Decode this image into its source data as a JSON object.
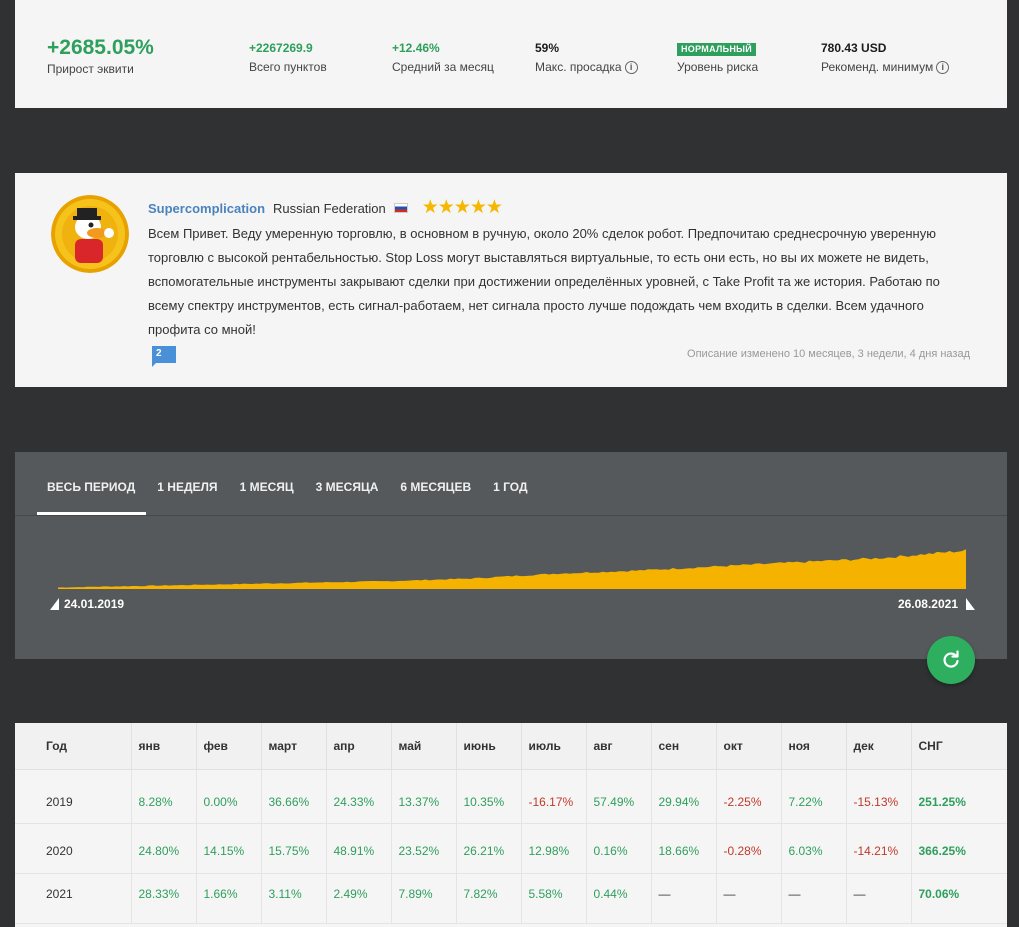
{
  "stats": [
    {
      "value": "+2685.05%",
      "label": "Прирост эквити"
    },
    {
      "value": "+2267269.9",
      "label": "Всего пунктов"
    },
    {
      "value": "+12.46%",
      "label": "Средний за месяц"
    },
    {
      "value": "59%",
      "label": "Макс. просадка"
    },
    {
      "value": "НОРМАЛЬНЫЙ",
      "label": "Уровень риска"
    },
    {
      "value": "780.43 USD",
      "label": "Рекоменд. минимум"
    }
  ],
  "review": {
    "author": "Supercomplication",
    "country": "Russian Federation",
    "stars": "★★★★★",
    "text": "Всем Привет. Веду умеренную торговлю, в основном в ручную, около 20% сделок робот. Предпочитаю среднесрочную уверенную торговлю с высокой рентабельностью. Stop Loss могут выставляться виртуальные, то есть они есть, но вы их можете не видеть, вспомогательные инструменты закрывают сделки при достижении определённых уровней, с Take Profit та же история. Работаю по всему спектру инструментов, есть сигнал-работаем, нет сигнала просто лучше подождать чем входить в сделки. Всем удачного профита со мной!",
    "comments": "2",
    "edited": "Описание изменено 10 месяцев, 3 недели, 4 дня назад"
  },
  "chart": {
    "tabs": [
      "ВЕСЬ ПЕРИОД",
      "1 НЕДЕЛЯ",
      "1 МЕСЯЦ",
      "3 МЕСЯЦА",
      "6 МЕСЯЦЕВ",
      "1 ГОД"
    ],
    "active_tab": "ВЕСЬ ПЕРИОД",
    "start_date": "24.01.2019",
    "end_date": "26.08.2021",
    "fill_color": "#f5b300",
    "background_color": "#56595b"
  },
  "chart_data": {
    "type": "area",
    "x": [
      "2019-01",
      "2019-04",
      "2019-07",
      "2019-10",
      "2020-01",
      "2020-04",
      "2020-07",
      "2020-10",
      "2021-01",
      "2021-04",
      "2021-07",
      "2021-08"
    ],
    "values": [
      0,
      1.5,
      3,
      4.5,
      6,
      8.5,
      13,
      16,
      20,
      24,
      28,
      35
    ],
    "xlabel": "",
    "ylabel": "",
    "grid": false,
    "legend": "none"
  },
  "table": {
    "headers": [
      "Год",
      "янв",
      "фев",
      "март",
      "апр",
      "май",
      "июнь",
      "июль",
      "авг",
      "сен",
      "окт",
      "ноя",
      "дек",
      "СНГ"
    ],
    "rows": [
      {
        "year": "2019",
        "cells": [
          "8.28%",
          "0.00%",
          "36.66%",
          "24.33%",
          "13.37%",
          "10.35%",
          "-16.17%",
          "57.49%",
          "29.94%",
          "-2.25%",
          "7.22%",
          "-15.13%"
        ],
        "total": "251.25%"
      },
      {
        "year": "2020",
        "cells": [
          "24.80%",
          "14.15%",
          "15.75%",
          "48.91%",
          "23.52%",
          "26.21%",
          "12.98%",
          "0.16%",
          "18.66%",
          "-0.28%",
          "6.03%",
          "-14.21%"
        ],
        "total": "366.25%"
      },
      {
        "year": "2021",
        "cells": [
          "28.33%",
          "1.66%",
          "3.11%",
          "2.49%",
          "7.89%",
          "7.82%",
          "5.58%",
          "0.44%",
          "—",
          "—",
          "—",
          "—"
        ],
        "total": "70.06%"
      }
    ]
  },
  "colors": {
    "positive": "#2e9f5c",
    "negative": "#c0392b",
    "accent": "#2eae5f",
    "author_link": "#4a83bd"
  }
}
